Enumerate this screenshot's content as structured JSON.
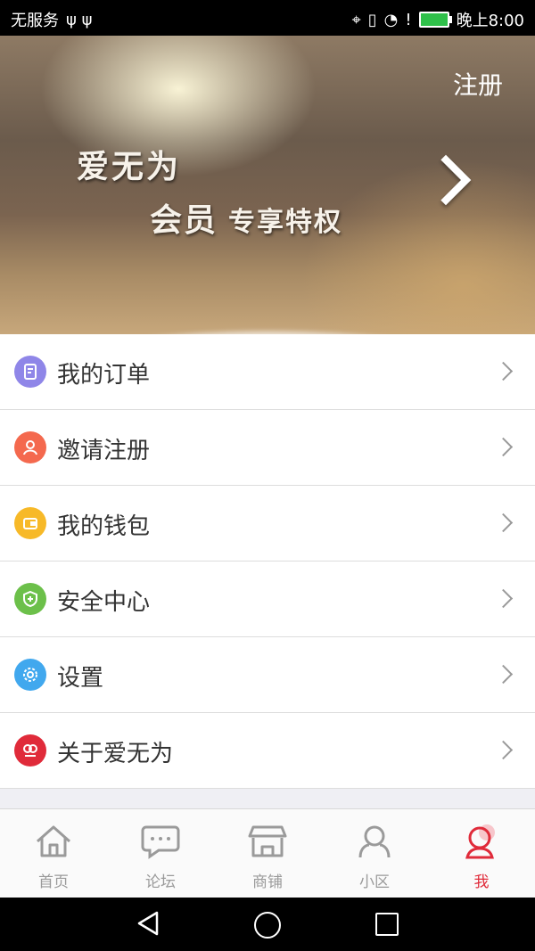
{
  "status_bar": {
    "carrier": "无服务",
    "time": "晚上8:00"
  },
  "banner": {
    "register_label": "注册",
    "promo_line1": "爱无为",
    "promo_line2_main": "会员",
    "promo_line2_sub": "专享特权"
  },
  "menu": {
    "items": [
      {
        "label": "我的订单",
        "icon": "order-icon",
        "color": "#8f86e8"
      },
      {
        "label": "邀请注册",
        "icon": "person-icon",
        "color": "#f4694e"
      },
      {
        "label": "我的钱包",
        "icon": "wallet-icon",
        "color": "#f7b928"
      },
      {
        "label": "安全中心",
        "icon": "shield-icon",
        "color": "#6cc04a"
      },
      {
        "label": "设置",
        "icon": "gear-icon",
        "color": "#41a8ee"
      },
      {
        "label": "关于爱无为",
        "icon": "app-logo-icon",
        "color": "#e02b3a"
      }
    ]
  },
  "tabbar": {
    "tabs": [
      {
        "label": "首页",
        "icon": "home-icon"
      },
      {
        "label": "论坛",
        "icon": "forum-icon"
      },
      {
        "label": "商铺",
        "icon": "shop-icon"
      },
      {
        "label": "小区",
        "icon": "community-icon"
      },
      {
        "label": "我",
        "icon": "profile-icon",
        "active": true
      }
    ],
    "active_color": "#e02b3a",
    "inactive_color": "#9a9a9a"
  }
}
